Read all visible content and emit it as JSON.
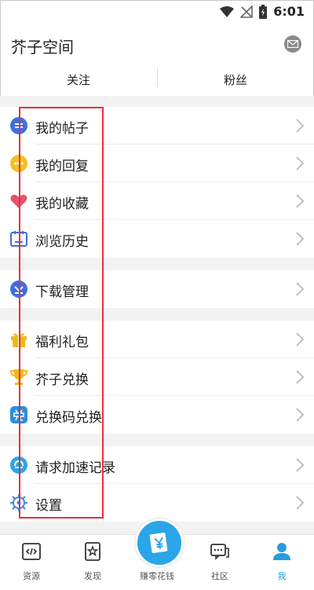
{
  "status": {
    "time": "6:01"
  },
  "header": {
    "title": "芥子空间"
  },
  "tabs": [
    {
      "label": "关注"
    },
    {
      "label": "粉丝"
    }
  ],
  "menu": {
    "posts": "我的帖子",
    "replies": "我的回复",
    "favorites": "我的收藏",
    "history": "浏览历史",
    "downloads": "下载管理",
    "gifts": "福利礼包",
    "exchange": "芥子兑换",
    "code_exchange": "兑换码兑换",
    "speedup_log": "请求加速记录",
    "settings": "设置"
  },
  "tabbar": {
    "resources": "资源",
    "discover": "发现",
    "earn": "赚零花钱",
    "community": "社区",
    "me": "我"
  },
  "colors": {
    "accent": "#2a9be0",
    "highlight_box": "#e8303a"
  }
}
